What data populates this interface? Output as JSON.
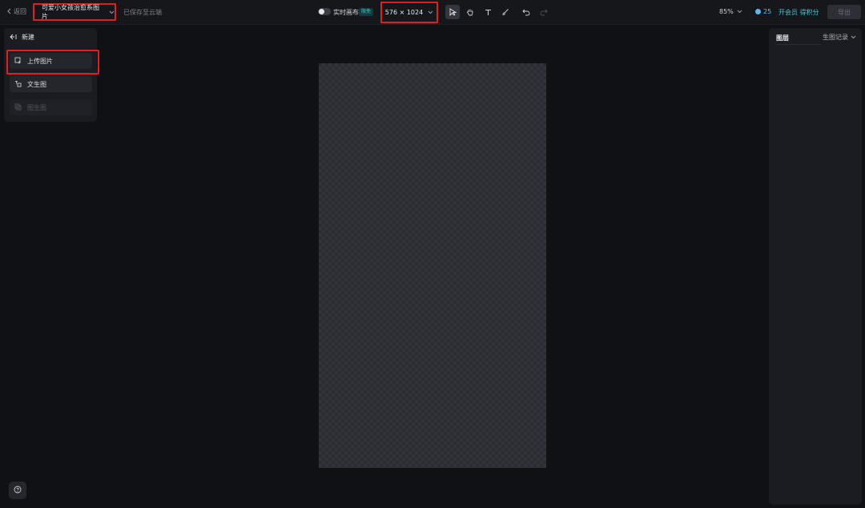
{
  "header": {
    "back_label": "返回",
    "project_title": "可爱小女孩治愈系图片",
    "save_status": "已保存至云端",
    "realtime_label": "实时画布",
    "realtime_badge": "限免",
    "canvas_size": "576 × 1024",
    "zoom": "85%",
    "credits": "25",
    "vip_text": "开会员 得积分",
    "export_label": "导出"
  },
  "left_panel": {
    "new_label": "新建",
    "items": [
      {
        "label": "上传图片",
        "icon": "upload-image-icon",
        "enabled": true
      },
      {
        "label": "文生图",
        "icon": "text-to-image-icon",
        "enabled": true
      },
      {
        "label": "图生图",
        "icon": "image-to-image-icon",
        "enabled": false
      }
    ]
  },
  "right_panel": {
    "tab_layers": "图层",
    "tab_history": "生图记录"
  },
  "tools": [
    "select-tool-icon",
    "hand-tool-icon",
    "text-tool-icon",
    "brush-tool-icon",
    "undo-icon",
    "redo-icon"
  ],
  "colors": {
    "highlight": "#e02020",
    "accent": "#3ec9d6",
    "background": "#101114"
  }
}
